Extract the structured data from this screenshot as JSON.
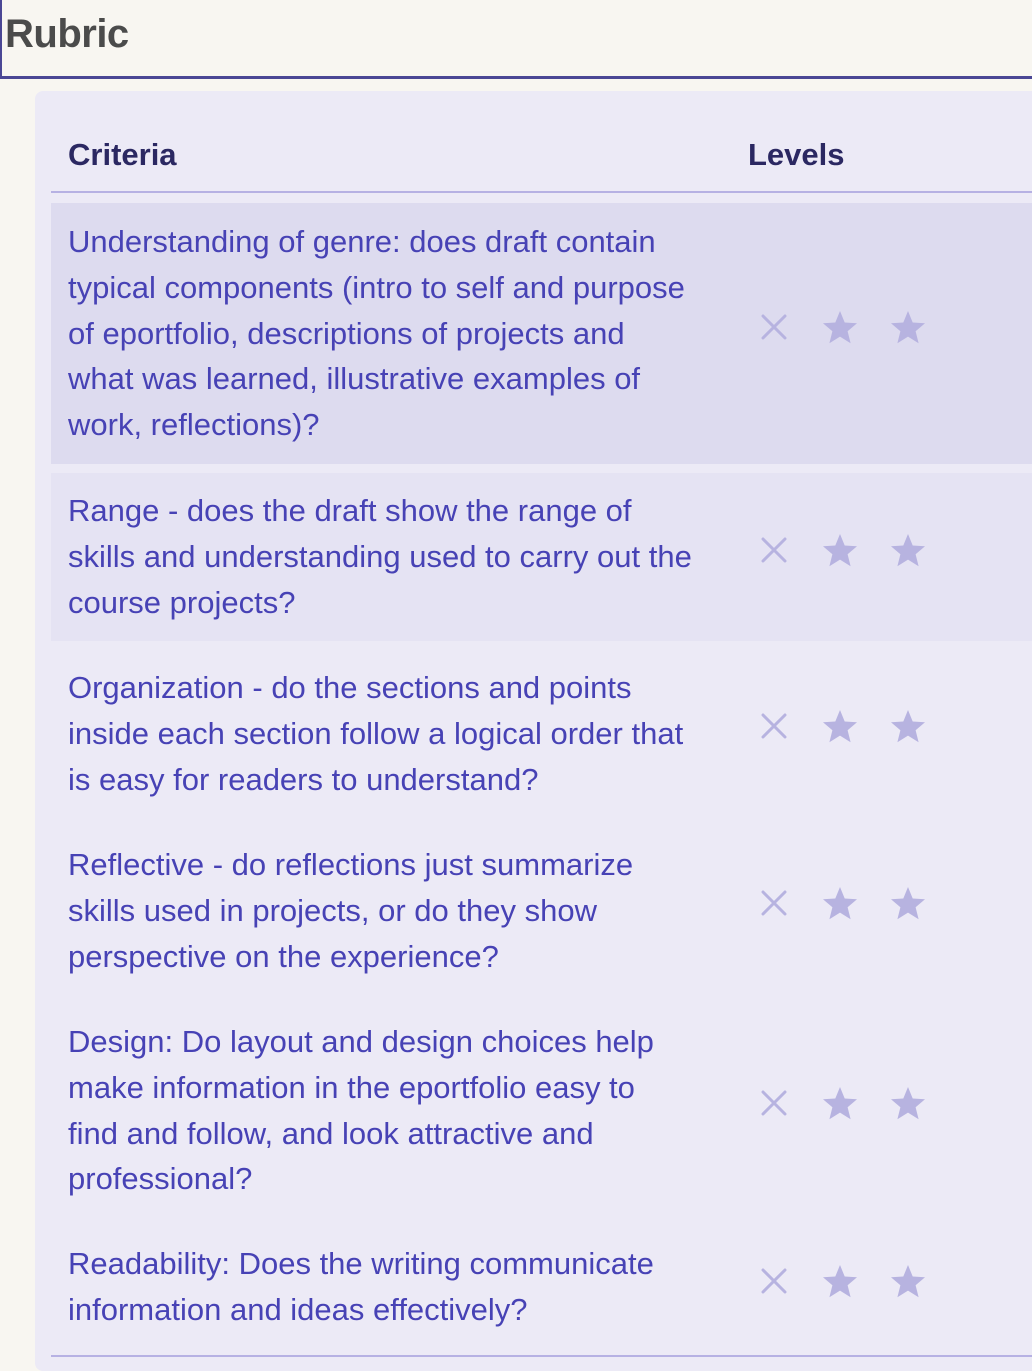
{
  "header": {
    "title": "Rubric"
  },
  "table": {
    "columns": {
      "criteria": "Criteria",
      "levels": "Levels"
    },
    "rows": [
      {
        "text": "Understanding of genre: does draft contain\ntypical components (intro to self and purpose\nof eportfolio, descriptions of projects and\nwhat was learned, illustrative examples of\nwork, reflections)?",
        "levels": [
          "x-icon",
          "star-icon",
          "star-icon"
        ]
      },
      {
        "text": "Range - does the draft show the range of\nskills and understanding used to carry out the\ncourse projects?",
        "levels": [
          "x-icon",
          "star-icon",
          "star-icon"
        ]
      },
      {
        "text": "Organization - do the sections and points\ninside each section follow a logical order that\nis easy for readers to understand?",
        "levels": [
          "x-icon",
          "star-icon",
          "star-icon"
        ]
      },
      {
        "text": "Reflective - do reflections just summarize\nskills used in projects, or do they show\nperspective on the experience?",
        "levels": [
          "x-icon",
          "star-icon",
          "star-icon"
        ]
      },
      {
        "text": "Design: Do layout and design choices help\nmake information in the eportfolio easy to\nfind and follow, and look attractive and\nprofessional?",
        "levels": [
          "x-icon",
          "star-icon",
          "star-icon"
        ]
      },
      {
        "text": "Readability: Does the writing communicate\ninformation and ideas effectively?",
        "levels": [
          "x-icon",
          "star-icon",
          "star-icon"
        ]
      }
    ]
  },
  "colors": {
    "accent": "#4b4795",
    "criteria_text": "#4742b5",
    "header_text": "#2b2862",
    "icon": "#b7b3e0",
    "row_highlight": "#dddbef",
    "row_hover": "#e5e3f3",
    "panel_bg": "#eceaf6",
    "page_bg": "#f8f6f1"
  }
}
